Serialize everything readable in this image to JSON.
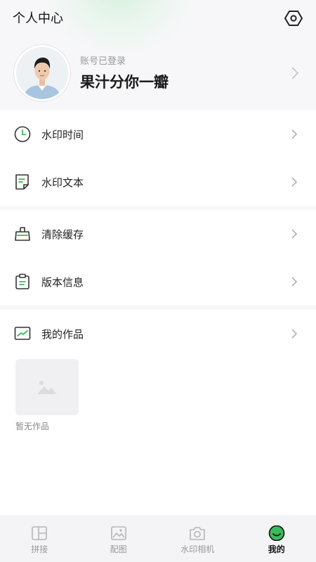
{
  "header": {
    "title": "个人中心",
    "settings_icon": "settings-gear-icon"
  },
  "profile": {
    "status": "账号已登录",
    "username": "果汁分你一瓣",
    "avatar": "user-avatar"
  },
  "menu": {
    "section1": [
      {
        "label": "水印时间",
        "icon": "clock-icon"
      },
      {
        "label": "水印文本",
        "icon": "note-icon"
      }
    ],
    "section2": [
      {
        "label": "清除缓存",
        "icon": "brush-icon"
      },
      {
        "label": "版本信息",
        "icon": "clipboard-icon"
      }
    ],
    "section3": [
      {
        "label": "我的作品",
        "icon": "chart-icon"
      }
    ]
  },
  "works": {
    "empty_text": "暂无作品",
    "placeholder_icon": "image-placeholder-icon"
  },
  "tabbar": {
    "tabs": [
      {
        "label": "拼接",
        "icon": "layout-icon",
        "active": false
      },
      {
        "label": "配图",
        "icon": "picture-icon",
        "active": false
      },
      {
        "label": "水印相机",
        "icon": "camera-icon",
        "active": false
      },
      {
        "label": "我的",
        "icon": "smile-icon",
        "active": true
      }
    ]
  },
  "colors": {
    "accent": "#3cb95a",
    "icon_dark": "#333333",
    "background": "#f7f7f9"
  }
}
